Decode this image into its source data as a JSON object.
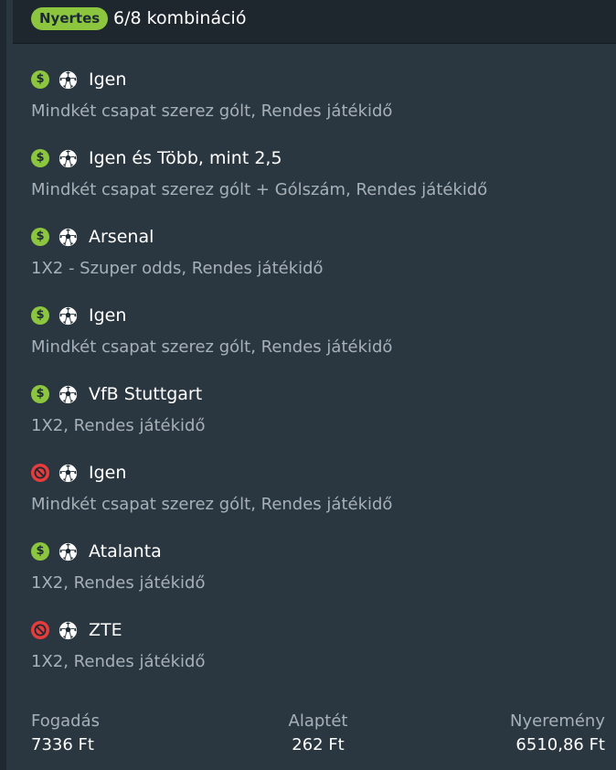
{
  "header": {
    "status_badge": "Nyertes",
    "combination": "6/8 kombináció"
  },
  "colors": {
    "won": "#8cc63f",
    "lost": "#e63c3c",
    "background": "#2b3740",
    "header_background": "#1f272e"
  },
  "selections": [
    {
      "status": "won",
      "status_icon": "dollar-icon",
      "sport_icon": "soccer-ball-icon",
      "pick": "Igen",
      "market": "Mindkét csapat szerez gólt, Rendes játékidő"
    },
    {
      "status": "won",
      "status_icon": "dollar-icon",
      "sport_icon": "soccer-ball-icon",
      "pick": "Igen és Több, mint 2,5",
      "market": "Mindkét csapat szerez gólt + Gólszám, Rendes játékidő"
    },
    {
      "status": "won",
      "status_icon": "dollar-icon",
      "sport_icon": "soccer-ball-icon",
      "pick": "Arsenal",
      "market": "1X2 - Szuper odds, Rendes játékidő"
    },
    {
      "status": "won",
      "status_icon": "dollar-icon",
      "sport_icon": "soccer-ball-icon",
      "pick": "Igen",
      "market": "Mindkét csapat szerez gólt, Rendes játékidő"
    },
    {
      "status": "won",
      "status_icon": "dollar-icon",
      "sport_icon": "soccer-ball-icon",
      "pick": "VfB Stuttgart",
      "market": "1X2, Rendes játékidő"
    },
    {
      "status": "lost",
      "status_icon": "no-money-icon",
      "sport_icon": "soccer-ball-icon",
      "pick": "Igen",
      "market": "Mindkét csapat szerez gólt, Rendes játékidő"
    },
    {
      "status": "won",
      "status_icon": "dollar-icon",
      "sport_icon": "soccer-ball-icon",
      "pick": "Atalanta",
      "market": "1X2, Rendes játékidő"
    },
    {
      "status": "lost",
      "status_icon": "no-money-icon",
      "sport_icon": "soccer-ball-icon",
      "pick": "ZTE",
      "market": "1X2, Rendes játékidő"
    }
  ],
  "footer": {
    "stake_label": "Fogadás",
    "stake_value": "7336 Ft",
    "base_stake_label": "Alaptét",
    "base_stake_value": "262 Ft",
    "winnings_label": "Nyeremény",
    "winnings_value": "6510,86 Ft"
  }
}
